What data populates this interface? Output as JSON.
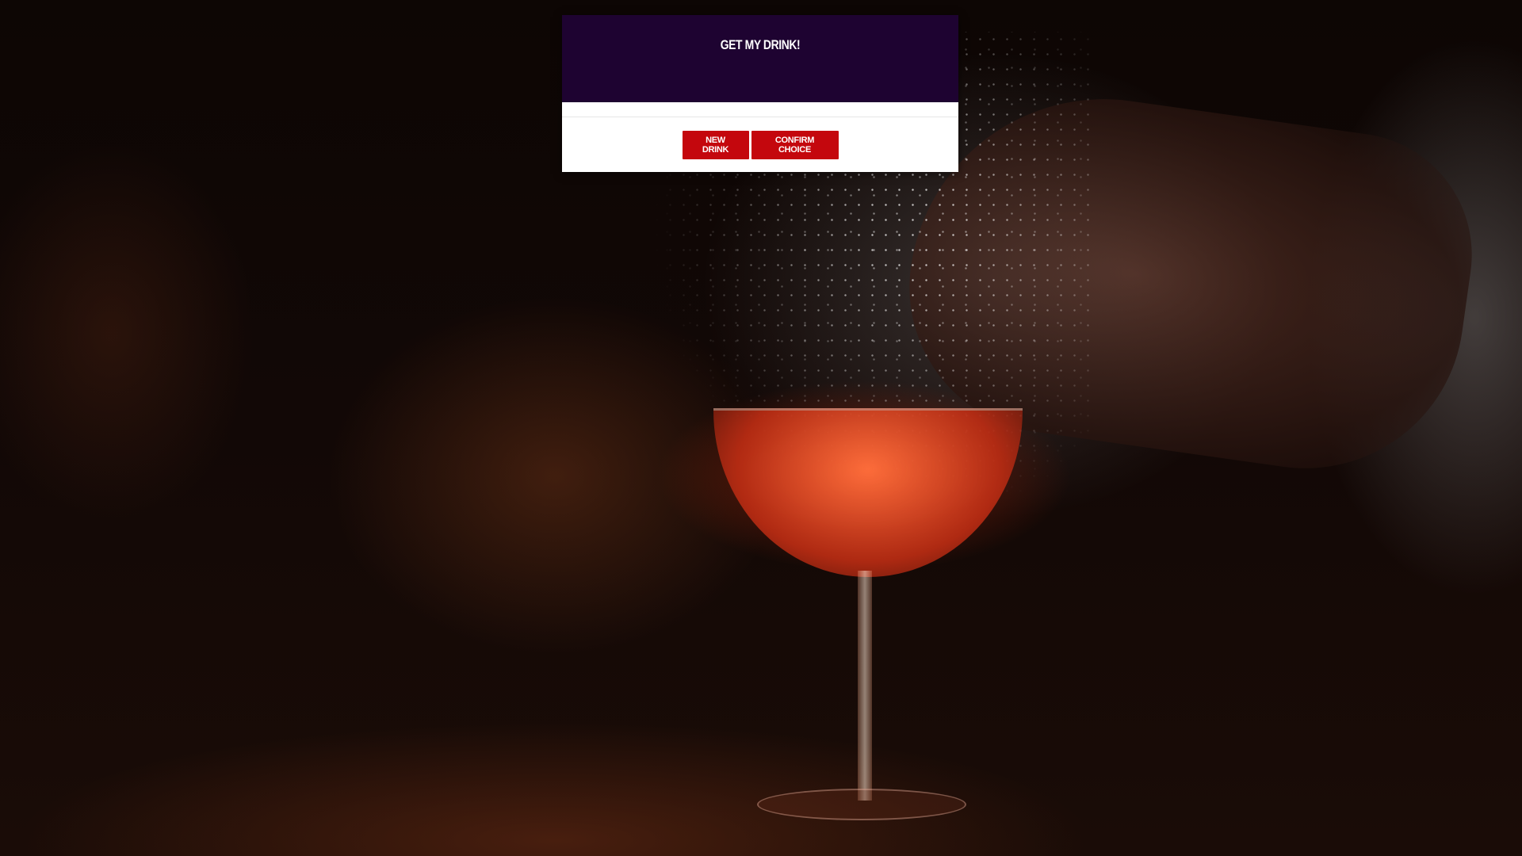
{
  "modal": {
    "title": "GET MY DRINK!",
    "buttons": {
      "new_drink": "NEW DRINK",
      "confirm_choice": "CONFIRM CHOICE"
    }
  },
  "colors": {
    "header_bg": "#1e0331",
    "button_bg": "#c4070d",
    "button_text": "#ffffff"
  },
  "background": {
    "image": "bartender-cocktail-spray-photo"
  }
}
